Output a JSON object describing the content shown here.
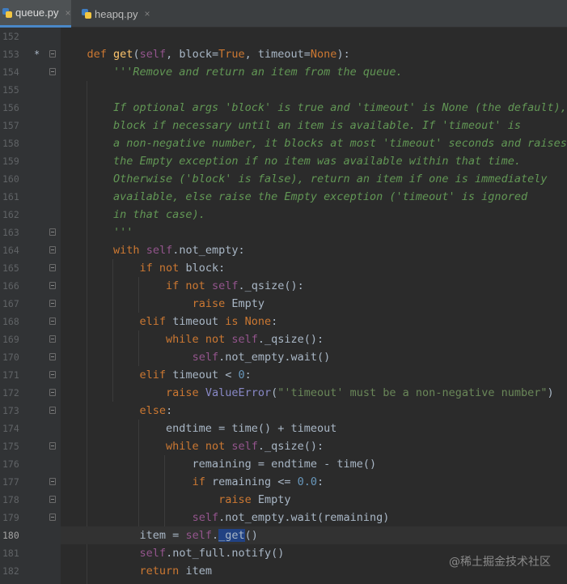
{
  "tabs": [
    {
      "label": "queue.py",
      "active": true,
      "icon": "python-file-icon",
      "close": "×"
    },
    {
      "label": "heapq.py",
      "active": false,
      "icon": "python-file-icon",
      "close": "×"
    }
  ],
  "colors": {
    "background": "#2b2b2b",
    "keyword": "#cc7832",
    "function": "#ffc66d",
    "self": "#94558d",
    "docstring": "#629755",
    "string": "#6a8759",
    "number": "#6897bb"
  },
  "editor": {
    "current_line": "180",
    "lines": [
      {
        "n": "152",
        "star": "",
        "fold": false,
        "tokens": []
      },
      {
        "n": "153",
        "star": "*",
        "fold": true,
        "tokens": [
          {
            "t": "    "
          },
          {
            "t": "def",
            "c": "kw"
          },
          {
            "t": " "
          },
          {
            "t": "get",
            "c": "fn"
          },
          {
            "t": "("
          },
          {
            "t": "self",
            "c": "self"
          },
          {
            "t": ", block="
          },
          {
            "t": "True",
            "c": "kw"
          },
          {
            "t": ", timeout="
          },
          {
            "t": "None",
            "c": "kw"
          },
          {
            "t": "):"
          }
        ]
      },
      {
        "n": "154",
        "star": "",
        "fold": true,
        "tokens": [
          {
            "t": "        "
          },
          {
            "t": "'''Remove and return an item from the queue.",
            "c": "doc"
          }
        ]
      },
      {
        "n": "155",
        "star": "",
        "fold": false,
        "tokens": []
      },
      {
        "n": "156",
        "star": "",
        "fold": false,
        "tokens": [
          {
            "t": "        "
          },
          {
            "t": "If optional args 'block' is true and 'timeout' is None (the default),",
            "c": "doc"
          }
        ]
      },
      {
        "n": "157",
        "star": "",
        "fold": false,
        "tokens": [
          {
            "t": "        "
          },
          {
            "t": "block if necessary until an item is available. If 'timeout' is",
            "c": "doc"
          }
        ]
      },
      {
        "n": "158",
        "star": "",
        "fold": false,
        "tokens": [
          {
            "t": "        "
          },
          {
            "t": "a non-negative number, it blocks at most 'timeout' seconds and raises",
            "c": "doc"
          }
        ]
      },
      {
        "n": "159",
        "star": "",
        "fold": false,
        "tokens": [
          {
            "t": "        "
          },
          {
            "t": "the Empty exception if no item was available within that time.",
            "c": "doc"
          }
        ]
      },
      {
        "n": "160",
        "star": "",
        "fold": false,
        "tokens": [
          {
            "t": "        "
          },
          {
            "t": "Otherwise ('block' is false), return an item if one is immediately",
            "c": "doc"
          }
        ]
      },
      {
        "n": "161",
        "star": "",
        "fold": false,
        "tokens": [
          {
            "t": "        "
          },
          {
            "t": "available, else raise the Empty exception ('timeout' is ignored",
            "c": "doc"
          }
        ]
      },
      {
        "n": "162",
        "star": "",
        "fold": false,
        "tokens": [
          {
            "t": "        "
          },
          {
            "t": "in that case).",
            "c": "doc"
          }
        ]
      },
      {
        "n": "163",
        "star": "",
        "fold": true,
        "tokens": [
          {
            "t": "        "
          },
          {
            "t": "'''",
            "c": "doc"
          }
        ]
      },
      {
        "n": "164",
        "star": "",
        "fold": true,
        "tokens": [
          {
            "t": "        "
          },
          {
            "t": "with",
            "c": "kw"
          },
          {
            "t": " "
          },
          {
            "t": "self",
            "c": "self"
          },
          {
            "t": ".not_empty:"
          }
        ]
      },
      {
        "n": "165",
        "star": "",
        "fold": true,
        "tokens": [
          {
            "t": "            "
          },
          {
            "t": "if not",
            "c": "kw"
          },
          {
            "t": " block:"
          }
        ]
      },
      {
        "n": "166",
        "star": "",
        "fold": true,
        "tokens": [
          {
            "t": "                "
          },
          {
            "t": "if not",
            "c": "kw"
          },
          {
            "t": " "
          },
          {
            "t": "self",
            "c": "self"
          },
          {
            "t": "._qsize():"
          }
        ]
      },
      {
        "n": "167",
        "star": "",
        "fold": true,
        "tokens": [
          {
            "t": "                    "
          },
          {
            "t": "raise",
            "c": "kw"
          },
          {
            "t": " Empty"
          }
        ]
      },
      {
        "n": "168",
        "star": "",
        "fold": true,
        "tokens": [
          {
            "t": "            "
          },
          {
            "t": "elif",
            "c": "kw"
          },
          {
            "t": " timeout "
          },
          {
            "t": "is",
            "c": "kw"
          },
          {
            "t": " "
          },
          {
            "t": "None",
            "c": "kw"
          },
          {
            "t": ":"
          }
        ]
      },
      {
        "n": "169",
        "star": "",
        "fold": true,
        "tokens": [
          {
            "t": "                "
          },
          {
            "t": "while not",
            "c": "kw"
          },
          {
            "t": " "
          },
          {
            "t": "self",
            "c": "self"
          },
          {
            "t": "._qsize():"
          }
        ]
      },
      {
        "n": "170",
        "star": "",
        "fold": true,
        "tokens": [
          {
            "t": "                    "
          },
          {
            "t": "self",
            "c": "self"
          },
          {
            "t": ".not_empty.wait()"
          }
        ]
      },
      {
        "n": "171",
        "star": "",
        "fold": true,
        "tokens": [
          {
            "t": "            "
          },
          {
            "t": "elif",
            "c": "kw"
          },
          {
            "t": " timeout < "
          },
          {
            "t": "0",
            "c": "num"
          },
          {
            "t": ":"
          }
        ]
      },
      {
        "n": "172",
        "star": "",
        "fold": true,
        "tokens": [
          {
            "t": "                "
          },
          {
            "t": "raise",
            "c": "kw"
          },
          {
            "t": " "
          },
          {
            "t": "ValueError",
            "c": "bi"
          },
          {
            "t": "("
          },
          {
            "t": "\"'timeout' must be a non-negative number\"",
            "c": "str"
          },
          {
            "t": ")"
          }
        ]
      },
      {
        "n": "173",
        "star": "",
        "fold": true,
        "tokens": [
          {
            "t": "            "
          },
          {
            "t": "else",
            "c": "kw"
          },
          {
            "t": ":"
          }
        ]
      },
      {
        "n": "174",
        "star": "",
        "fold": false,
        "tokens": [
          {
            "t": "                endtime = time() + timeout"
          }
        ]
      },
      {
        "n": "175",
        "star": "",
        "fold": true,
        "tokens": [
          {
            "t": "                "
          },
          {
            "t": "while not",
            "c": "kw"
          },
          {
            "t": " "
          },
          {
            "t": "self",
            "c": "self"
          },
          {
            "t": "._qsize():"
          }
        ]
      },
      {
        "n": "176",
        "star": "",
        "fold": false,
        "tokens": [
          {
            "t": "                    remaining = endtime - time()"
          }
        ]
      },
      {
        "n": "177",
        "star": "",
        "fold": true,
        "tokens": [
          {
            "t": "                    "
          },
          {
            "t": "if",
            "c": "kw"
          },
          {
            "t": " remaining <= "
          },
          {
            "t": "0.0",
            "c": "num"
          },
          {
            "t": ":"
          }
        ]
      },
      {
        "n": "178",
        "star": "",
        "fold": true,
        "tokens": [
          {
            "t": "                        "
          },
          {
            "t": "raise",
            "c": "kw"
          },
          {
            "t": " Empty"
          }
        ]
      },
      {
        "n": "179",
        "star": "",
        "fold": true,
        "tokens": [
          {
            "t": "                    "
          },
          {
            "t": "self",
            "c": "self"
          },
          {
            "t": ".not_empty.wait(remaining)"
          }
        ]
      },
      {
        "n": "180",
        "star": "",
        "fold": false,
        "tokens": [
          {
            "t": "            item = "
          },
          {
            "t": "self",
            "c": "self"
          },
          {
            "t": "."
          },
          {
            "t": "_get",
            "c": "sel"
          },
          {
            "t": "()"
          }
        ]
      },
      {
        "n": "181",
        "star": "",
        "fold": false,
        "tokens": [
          {
            "t": "            "
          },
          {
            "t": "self",
            "c": "self"
          },
          {
            "t": ".not_full.notify()"
          }
        ]
      },
      {
        "n": "182",
        "star": "",
        "fold": false,
        "tokens": [
          {
            "t": "            "
          },
          {
            "t": "return",
            "c": "kw"
          },
          {
            "t": " item"
          }
        ]
      }
    ]
  },
  "watermark": "@稀土掘金技术社区"
}
